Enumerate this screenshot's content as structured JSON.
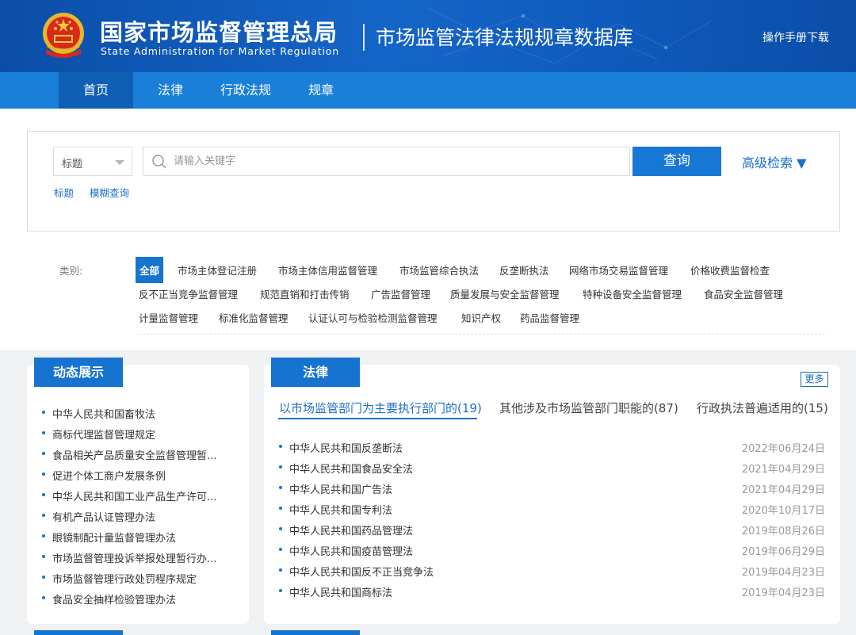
{
  "header": {
    "org_cn": "国家市场监督管理总局",
    "org_en": "State Administration for Market Regulation",
    "db_title": "市场监管法律法规规章数据库",
    "manual_link": "操作手册下载"
  },
  "nav": {
    "items": [
      {
        "label": "首页",
        "active": true
      },
      {
        "label": "法律",
        "active": false
      },
      {
        "label": "行政法规",
        "active": false
      },
      {
        "label": "规章",
        "active": false
      }
    ]
  },
  "search": {
    "select_value": "标题",
    "placeholder": "请输入关键字",
    "query_button": "查询",
    "advanced": "高级检索 ▼",
    "sub_links": [
      "标题",
      "模糊查询"
    ]
  },
  "categories": {
    "label": "类别:",
    "rows": [
      [
        "全部",
        "市场主体登记注册",
        "市场主体信用监督管理",
        "市场监管综合执法",
        "反垄断执法",
        "网络市场交易监督管理",
        "价格收费监督检查"
      ],
      [
        "反不正当竞争监督管理",
        "规范直销和打击传销",
        "广告监督管理",
        "质量发展与安全监督管理",
        "特种设备安全监督管理",
        "食品安全监督管理"
      ],
      [
        "计量监督管理",
        "标准化监督管理",
        "认证认可与检验检测监督管理",
        "知识产权",
        "药品监督管理"
      ]
    ]
  },
  "dynamic": {
    "title": "动态展示",
    "items": [
      "中华人民共和国畜牧法",
      "商标代理监督管理规定",
      "食品相关产品质量安全监督管理暂...",
      "促进个体工商户发展条例",
      "中华人民共和国工业产品生产许可...",
      "有机产品认证管理办法",
      "眼镜制配计量监督管理办法",
      "市场监督管理投诉举报处理暂行办...",
      "市场监督管理行政处罚程序规定",
      "食品安全抽样检验管理办法"
    ]
  },
  "law": {
    "title": "法律",
    "more": "更多",
    "subtabs": [
      {
        "label": "以市场监管部门为主要执行部门的(19)",
        "active": true
      },
      {
        "label": "其他涉及市场监管部门职能的(87)",
        "active": false
      },
      {
        "label": "行政执法普遍适用的(15)",
        "active": false
      }
    ],
    "rows": [
      {
        "title": "中华人民共和国反垄断法",
        "date": "2022年06月24日"
      },
      {
        "title": "中华人民共和国食品安全法",
        "date": "2021年04月29日"
      },
      {
        "title": "中华人民共和国广告法",
        "date": "2021年04月29日"
      },
      {
        "title": "中华人民共和国专利法",
        "date": "2020年10月17日"
      },
      {
        "title": "中华人民共和国药品管理法",
        "date": "2019年08月26日"
      },
      {
        "title": "中华人民共和国疫苗管理法",
        "date": "2019年06月29日"
      },
      {
        "title": "中华人民共和国反不正当竞争法",
        "date": "2019年04月23日"
      },
      {
        "title": "中华人民共和国商标法",
        "date": "2019年04月23日"
      }
    ]
  },
  "colors": {
    "primary": "#1673d0",
    "header_bg": "#0f5bbd",
    "nav_bg": "#1a7fd8",
    "nav_active": "#0f5fb4",
    "link": "#1a6fc8"
  }
}
